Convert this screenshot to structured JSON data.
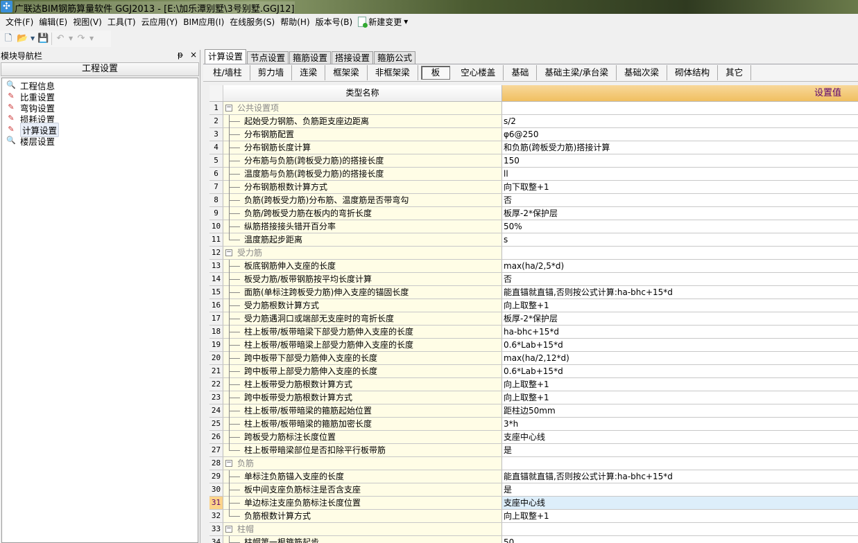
{
  "window": {
    "title": "广联达BIM钢筋算量软件 GGJ2013 - [E:\\加乐潭别墅\\3号别墅.GGJ12]"
  },
  "menu": [
    "文件(F)",
    "编辑(E)",
    "视图(V)",
    "工具(T)",
    "云应用(Y)",
    "BIM应用(I)",
    "在线服务(S)",
    "帮助(H)",
    "版本号(B)"
  ],
  "menu_new_change": "新建变更",
  "nav": {
    "title": "模块导航栏",
    "pin": "ᵽ",
    "close": "×",
    "section": "工程设置",
    "items": [
      {
        "label": "工程信息",
        "icon": "🔍"
      },
      {
        "label": "比重设置",
        "icon": "✎"
      },
      {
        "label": "弯钩设置",
        "icon": "✎"
      },
      {
        "label": "损耗设置",
        "icon": "✎"
      },
      {
        "label": "计算设置",
        "icon": "✎"
      },
      {
        "label": "楼层设置",
        "icon": "🔍"
      }
    ],
    "selected": 4
  },
  "tabs": [
    "计算设置",
    "节点设置",
    "箍筋设置",
    "搭接设置",
    "箍筋公式"
  ],
  "subtabs": [
    "柱/墙柱",
    "剪力墙",
    "连梁",
    "框架梁",
    "非框架梁",
    "板",
    "空心楼盖",
    "基础",
    "基础主梁/承台梁",
    "基础次梁",
    "砌体结构",
    "其它"
  ],
  "active_subtab": 5,
  "grid": {
    "col_name": "类型名称",
    "col_value": "设置值",
    "selected_row": 31,
    "rows": [
      {
        "n": "1",
        "g": true,
        "name": "公共设置项",
        "v": ""
      },
      {
        "n": "2",
        "name": "起始受力钢筋、负筋距支座边距离",
        "v": "s/2"
      },
      {
        "n": "3",
        "name": "分布钢筋配置",
        "v": "φ6@250"
      },
      {
        "n": "4",
        "name": "分布钢筋长度计算",
        "v": "和负筋(跨板受力筋)搭接计算"
      },
      {
        "n": "5",
        "name": "分布筋与负筋(跨板受力筋)的搭接长度",
        "v": "150"
      },
      {
        "n": "6",
        "name": "温度筋与负筋(跨板受力筋)的搭接长度",
        "v": "ll"
      },
      {
        "n": "7",
        "name": "分布钢筋根数计算方式",
        "v": "向下取整+1"
      },
      {
        "n": "8",
        "name": "负筋(跨板受力筋)分布筋、温度筋是否带弯勾",
        "v": "否"
      },
      {
        "n": "9",
        "name": "负筋/跨板受力筋在板内的弯折长度",
        "v": "板厚-2*保护层"
      },
      {
        "n": "10",
        "name": "纵筋搭接接头错开百分率",
        "v": "50%"
      },
      {
        "n": "11",
        "name": "温度筋起步距离",
        "v": "s",
        "last": true
      },
      {
        "n": "12",
        "g": true,
        "name": "受力筋",
        "v": ""
      },
      {
        "n": "13",
        "name": "板底钢筋伸入支座的长度",
        "v": "max(ha/2,5*d)"
      },
      {
        "n": "14",
        "name": "板受力筋/板带钢筋按平均长度计算",
        "v": "否"
      },
      {
        "n": "15",
        "name": "面筋(单标注跨板受力筋)伸入支座的锚固长度",
        "v": "能直锚就直锚,否则按公式计算:ha-bhc+15*d"
      },
      {
        "n": "16",
        "name": "受力筋根数计算方式",
        "v": "向上取整+1"
      },
      {
        "n": "17",
        "name": "受力筋遇洞口或端部无支座时的弯折长度",
        "v": "板厚-2*保护层"
      },
      {
        "n": "18",
        "name": "柱上板带/板带暗梁下部受力筋伸入支座的长度",
        "v": "ha-bhc+15*d"
      },
      {
        "n": "19",
        "name": "柱上板带/板带暗梁上部受力筋伸入支座的长度",
        "v": "0.6*Lab+15*d"
      },
      {
        "n": "20",
        "name": "跨中板带下部受力筋伸入支座的长度",
        "v": "max(ha/2,12*d)"
      },
      {
        "n": "21",
        "name": "跨中板带上部受力筋伸入支座的长度",
        "v": "0.6*Lab+15*d"
      },
      {
        "n": "22",
        "name": "柱上板带受力筋根数计算方式",
        "v": "向上取整+1"
      },
      {
        "n": "23",
        "name": "跨中板带受力筋根数计算方式",
        "v": "向上取整+1"
      },
      {
        "n": "24",
        "name": "柱上板带/板带暗梁的箍筋起始位置",
        "v": "距柱边50mm"
      },
      {
        "n": "25",
        "name": "柱上板带/板带暗梁的箍筋加密长度",
        "v": "3*h"
      },
      {
        "n": "26",
        "name": "跨板受力筋标注长度位置",
        "v": "支座中心线"
      },
      {
        "n": "27",
        "name": "柱上板带暗梁部位是否扣除平行板带筋",
        "v": "是",
        "last": true
      },
      {
        "n": "28",
        "g": true,
        "name": "负筋",
        "v": ""
      },
      {
        "n": "29",
        "name": "单标注负筋锚入支座的长度",
        "v": "能直锚就直锚,否则按公式计算:ha-bhc+15*d"
      },
      {
        "n": "30",
        "name": "板中间支座负筋标注是否含支座",
        "v": "是"
      },
      {
        "n": "31",
        "name": "单边标注支座负筋标注长度位置",
        "v": "支座中心线"
      },
      {
        "n": "32",
        "name": "负筋根数计算方式",
        "v": "向上取整+1",
        "last": true
      },
      {
        "n": "33",
        "g": true,
        "name": "柱帽",
        "v": ""
      },
      {
        "n": "34",
        "name": "柱帽第一根箍筋起步",
        "v": "50"
      }
    ]
  }
}
